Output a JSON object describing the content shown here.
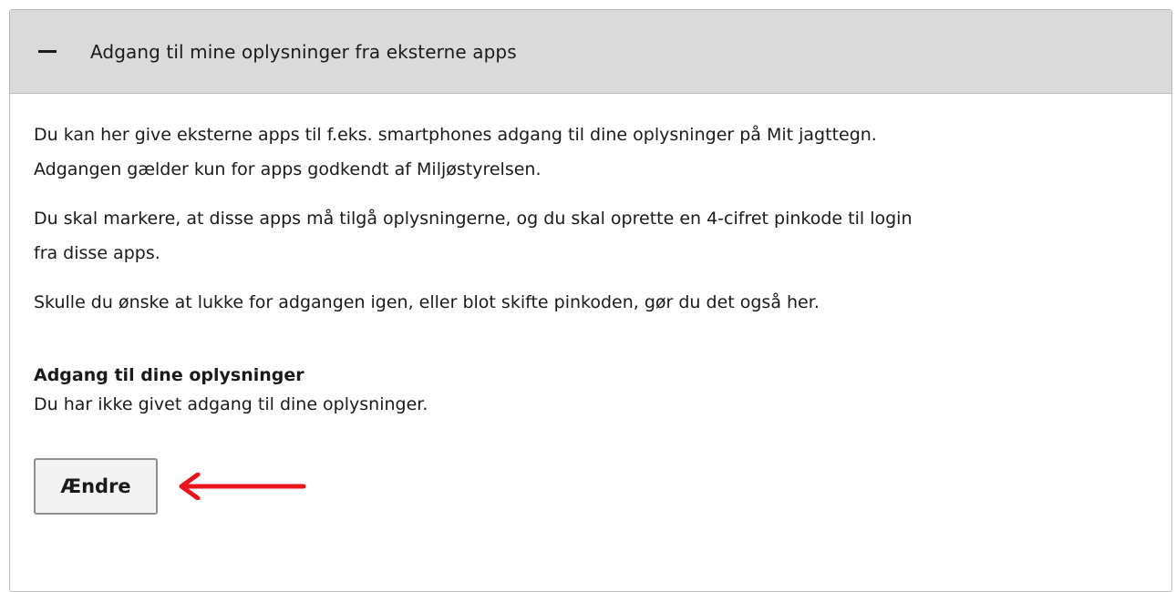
{
  "accordion": {
    "title": "Adgang til mine oplysninger fra eksterne apps",
    "toggle_icon": "minus-icon",
    "expanded": true
  },
  "content": {
    "paragraphs": [
      "Du kan her give eksterne apps til f.eks. smartphones adgang til dine oplysninger på Mit jagttegn. Adgangen gælder kun for apps godkendt af Miljøstyrelsen.",
      "Du skal markere, at disse apps må tilgå oplysningerne, og du skal oprette en 4-cifret pinkode til login fra disse apps.",
      "Skulle du ønske at lukke for adgangen igen, eller blot skifte pinkoden, gør du det også her."
    ],
    "access_heading": "Adgang til dine oplysninger",
    "access_status": "Du har ikke givet adgang til dine oplysninger.",
    "change_button_label": "Ændre"
  },
  "annotation": {
    "arrow_color": "#e8161c",
    "arrow_icon": "left-arrow-icon"
  },
  "colors": {
    "header_bg": "#dadada",
    "border": "#b9b9b9",
    "text": "#1a1a1a"
  }
}
